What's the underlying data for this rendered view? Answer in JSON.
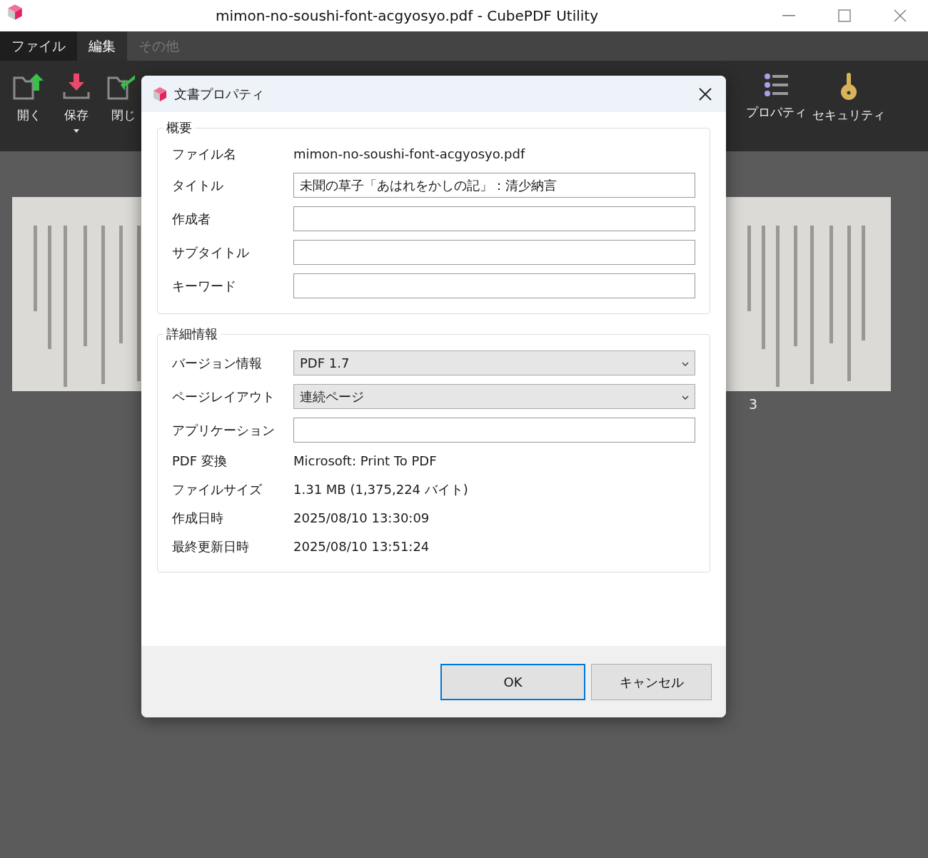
{
  "window": {
    "title": "mimon-no-soushi-font-acgyosyo.pdf - CubePDF Utility"
  },
  "menu_tabs": [
    {
      "label": "ファイル",
      "kind": "file",
      "selected": false,
      "disabled": false
    },
    {
      "label": "編集",
      "kind": "tab",
      "selected": true,
      "disabled": false
    },
    {
      "label": "その他",
      "kind": "tab",
      "selected": false,
      "disabled": true
    }
  ],
  "toolbar_left": [
    {
      "label": "開く",
      "kind": "open",
      "dropdown": false
    },
    {
      "label": "保存",
      "kind": "save",
      "dropdown": true
    },
    {
      "label": "閉じ",
      "kind": "close",
      "dropdown": false
    }
  ],
  "toolbar_right": [
    {
      "label": "プロパティ",
      "kind": "properties",
      "dropdown": false
    },
    {
      "label": "セキュリティ",
      "kind": "security",
      "dropdown": false
    }
  ],
  "pages": [
    {
      "kind": "picture"
    },
    {
      "kind": "picture",
      "number": "3"
    }
  ],
  "dialog": {
    "title": "文書プロパティ",
    "groups": [
      {
        "title": "概要",
        "rows": [
          {
            "label": "ファイル名",
            "kind": "text",
            "value": "mimon-no-soushi-font-acgyosyo.pdf"
          },
          {
            "label": "タイトル",
            "kind": "input",
            "value": "未聞の草子「あはれをかしの記」：清少納言"
          },
          {
            "label": "作成者",
            "kind": "input"
          },
          {
            "label": "サブタイトル",
            "kind": "input"
          },
          {
            "label": "キーワード",
            "kind": "input"
          }
        ]
      },
      {
        "title": "詳細情報",
        "rows": [
          {
            "label": "バージョン情報",
            "kind": "select",
            "value": "PDF 1.7"
          },
          {
            "label": "ページレイアウト",
            "kind": "select",
            "value": "連続ページ"
          },
          {
            "label": "アプリケーション",
            "kind": "input"
          },
          {
            "label": "PDF 変換",
            "kind": "text",
            "value": "Microsoft: Print To PDF"
          },
          {
            "label": "ファイルサイズ",
            "kind": "text",
            "value": "1.31 MB (1,375,224 バイト)"
          },
          {
            "label": "作成日時",
            "kind": "text",
            "value": "2025/08/10 13:30:09"
          },
          {
            "label": "最終更新日時",
            "kind": "text",
            "value": "2025/08/10 13:51:24"
          }
        ]
      }
    ],
    "buttons": [
      {
        "label": "OK",
        "kind": "default"
      },
      {
        "label": "キャンセル",
        "kind": "normal"
      }
    ]
  }
}
